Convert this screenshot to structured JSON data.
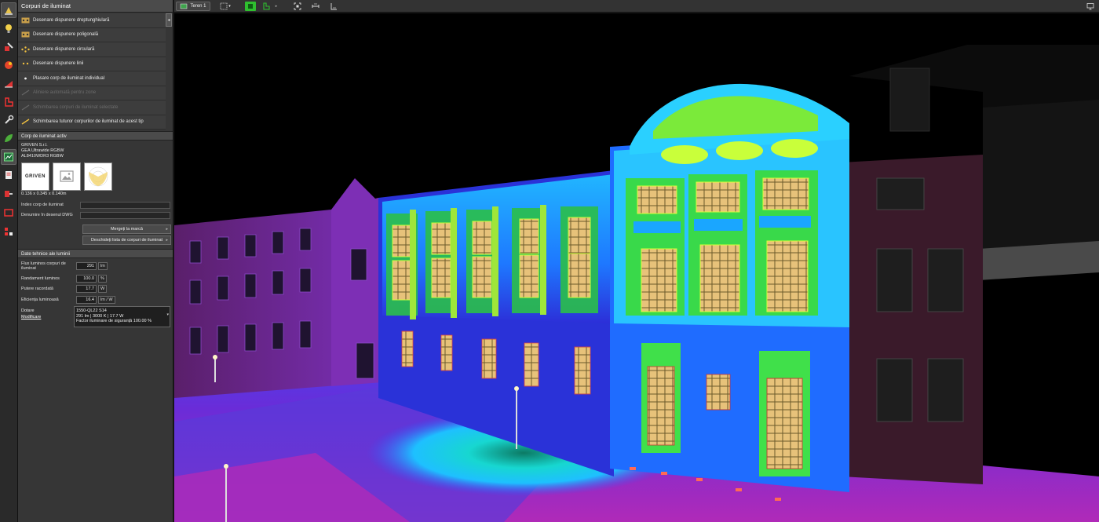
{
  "panel": {
    "title": "Corpuri de iluminat",
    "collapse": "◂",
    "menu": [
      {
        "label": "Desenare dispunere dreptunghiulară",
        "icon": "rect-layout-icon",
        "enabled": true
      },
      {
        "label": "Desenare dispunere poligonală",
        "icon": "polygon-layout-icon",
        "enabled": true
      },
      {
        "label": "Desenare dispunere circulară",
        "icon": "circle-layout-icon",
        "enabled": true
      },
      {
        "label": "Desenare dispunere linii",
        "icon": "line-layout-icon",
        "enabled": true
      },
      {
        "label": "Plasare corp de iluminat individual",
        "icon": "single-luminaire-icon",
        "enabled": true
      },
      {
        "label": "Aliniere automată pentru zone",
        "icon": "align-icon",
        "enabled": false
      },
      {
        "label": "Schimbarea corpuri de iluminat selectate",
        "icon": "swap-selected-icon",
        "enabled": false
      },
      {
        "label": "Schimbarea tuturor corpurilor de iluminat de acest tip",
        "icon": "swap-all-icon",
        "enabled": true
      }
    ]
  },
  "active_luminaire": {
    "heading": "Corp de iluminat activ",
    "manufacturer": "GRIVEN S.r.l.",
    "model": "GEA Ultrawide RGBW",
    "code": "AL8410WDR3 RGBW",
    "logo_text": "GRIVEN",
    "dimensions": "0.136 x 0.345 x 0.140m",
    "index_label": "Index corp de iluminat",
    "dwg_label": "Denumire în desenul DWG",
    "goto_brand": "Mergeți la marcă",
    "open_list": "Deschideți lista de corpuri de iluminat"
  },
  "technical": {
    "heading": "Date tehnice ale luminii",
    "flux_label": "Flux luminos corpuri de iluminat",
    "flux_value": "291",
    "flux_unit": "lm",
    "efficiency_label": "Randament luminos",
    "efficiency_value": "100.0",
    "efficiency_unit": "%",
    "power_label": "Putere racordată",
    "power_value": "17.7",
    "power_unit": "W",
    "efficacy_label": "Eficiența luminoasă",
    "efficacy_value": "16.4",
    "efficacy_unit": "lm / W",
    "dotare_label": "Dotare",
    "modify_label": "Modificare",
    "dotare_line1": "1550-QL22 S14",
    "dotare_line2": "291 lm  |  3000 K  |  17.7 W",
    "dotare_line3": "Factor iluminare de siguranță 100.00 %"
  },
  "toolbar": {
    "terrain_label": "Teren 1"
  },
  "colors": {
    "panel_bg": "#363636",
    "accent_green": "#2fbf2f",
    "viewport_bg": "#000000"
  }
}
